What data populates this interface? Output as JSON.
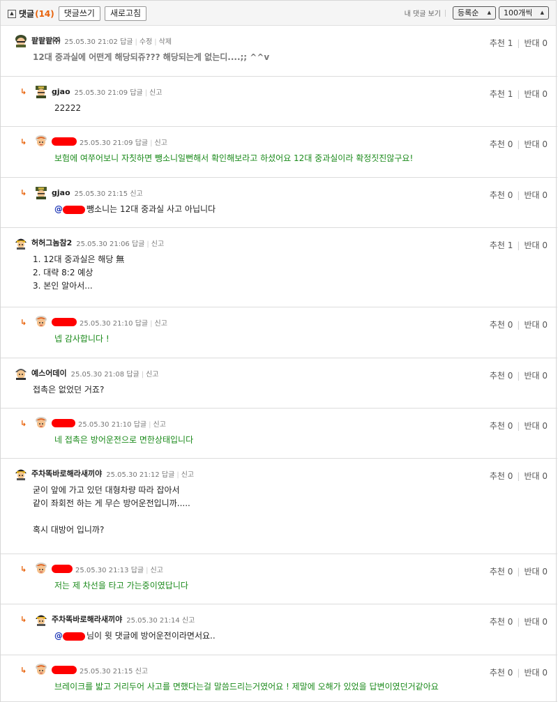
{
  "toolbar": {
    "collapse_icon": "▲",
    "label": "댓글",
    "count": "(14)",
    "write_btn": "댓글쓰기",
    "refresh_btn": "새로고침",
    "my_comments": "내 댓글 보기",
    "sort": "등록순",
    "per_page": "100개씩"
  },
  "vote_up_label": "추천",
  "vote_down_label": "반대",
  "meta_reply": "답글",
  "meta_edit": "수정",
  "meta_delete": "삭제",
  "meta_report": "신고",
  "reply_arrow": "↳",
  "comments": [
    {
      "nick": "팥팥팥㈜",
      "time": "25.05.30 21:02",
      "up": "1",
      "down": "0",
      "lines": [
        "12대 중과실에 어떤게 해당되쥬??? 해당되는게 없는디....;; ^^v"
      ]
    },
    {
      "nick": "gjao",
      "time": "25.05.30 21:09",
      "up": "1",
      "down": "0",
      "lines": [
        "22222"
      ]
    },
    {
      "nick": "",
      "time": "25.05.30 21:09",
      "up": "0",
      "down": "0",
      "lines": [
        "보험에 여쭈어보니 자칫하면 뺑소니일뻔해서 확인해보라고 하셨어요 12대 중과실이라 확정짓진않구요!"
      ]
    },
    {
      "nick": "gjao",
      "time": "25.05.30 21:15",
      "up": "0",
      "down": "0",
      "lines": [
        "뺑소니는 12대 중과실 사고 아닙니다"
      ],
      "mention": "@"
    },
    {
      "nick": "허허그놈참2",
      "time": "25.05.30 21:06",
      "up": "1",
      "down": "0",
      "lines": [
        "1. 12대 중과실은 해당 無",
        "2. 대략 8:2 예상",
        "3. 본인 알아서..."
      ]
    },
    {
      "nick": "",
      "time": "25.05.30 21:10",
      "up": "0",
      "down": "0",
      "lines": [
        "넵 감사합니다 !"
      ]
    },
    {
      "nick": "예스어데이",
      "time": "25.05.30 21:08",
      "up": "0",
      "down": "0",
      "lines": [
        "접촉은 없었던 거죠?"
      ]
    },
    {
      "nick": "",
      "time": "25.05.30 21:10",
      "up": "0",
      "down": "0",
      "lines": [
        "네 접촉은 방어운전으로 면한상태입니다"
      ]
    },
    {
      "nick": "주차똑바로해라새끼야",
      "time": "25.05.30 21:12",
      "up": "0",
      "down": "0",
      "lines": [
        "굳이 앞에 가고 있던 대형차량 따라 잡아서",
        "같이 좌회전 하는 게 무슨 방어운전입니까.....",
        "",
        "혹시 대방어 입니까?"
      ]
    },
    {
      "nick": "",
      "time": "25.05.30 21:13",
      "up": "0",
      "down": "0",
      "lines": [
        "저는 제 차선을 타고 가는중이였답니다"
      ]
    },
    {
      "nick": "주차똑바로해라새끼야",
      "time": "25.05.30 21:14",
      "up": "0",
      "down": "0",
      "lines": [
        "님이 윗 댓글에 방어운전이라면서요.."
      ],
      "mention": "@"
    },
    {
      "nick": "",
      "time": "25.05.30 21:15",
      "up": "0",
      "down": "0",
      "lines": [
        "브레이크를 밟고 거리두어 사고를 면했다는걸 말씀드리는거였어요 ! 제말에 오해가 있었을 답변이였던거같아요"
      ]
    }
  ]
}
